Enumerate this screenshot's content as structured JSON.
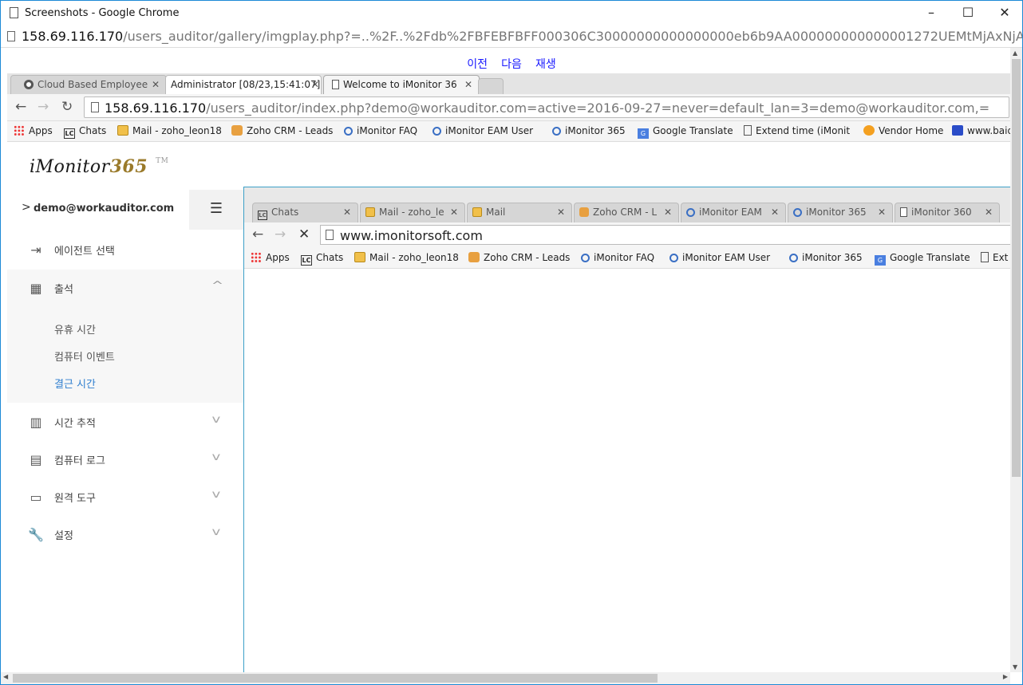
{
  "window": {
    "title": "Screenshots - Google Chrome",
    "url_host": "158.69.116.170",
    "url_path": "/users_auditor/gallery/imgplay.php?=..%2F..%2Fdb%2FBFEBFBFF000306C30000000000000000eb6b9AA000000000000001272UEMtMjAxNjA1MTQxN"
  },
  "player_nav": {
    "prev": "이전",
    "next": "다음",
    "play": "재생"
  },
  "inner_browser": {
    "tabs": [
      {
        "label": "Cloud Based Employee"
      },
      {
        "label": "Administrator [08/23,15:41:07]"
      },
      {
        "label": "Welcome to iMonitor 36"
      }
    ],
    "url_host": "158.69.116.170",
    "url_path": "/users_auditor/index.php?demo@workauditor.com=active=2016-09-27=never=default_lan=3=demo@workauditor.com,=",
    "bookmarks": [
      {
        "label": "Apps",
        "icon": "apps-icon"
      },
      {
        "label": "Chats",
        "icon": "lc-icon"
      },
      {
        "label": "Mail - zoho_leon18",
        "icon": "mail-icon"
      },
      {
        "label": "Zoho CRM - Leads",
        "icon": "crm-icon"
      },
      {
        "label": "iMonitor FAQ",
        "icon": "magnifier-icon"
      },
      {
        "label": "iMonitor EAM User",
        "icon": "magnifier-icon"
      },
      {
        "label": "iMonitor 365",
        "icon": "magnifier-icon"
      },
      {
        "label": "Google Translate",
        "icon": "translate-icon"
      },
      {
        "label": "Extend time (iMonit",
        "icon": "document-icon"
      },
      {
        "label": "Vendor Home",
        "icon": "vendor-icon"
      },
      {
        "label": "www.baid",
        "icon": "paw-icon"
      }
    ]
  },
  "app": {
    "logo_main": "iMonitor",
    "logo_accent": "365",
    "logo_tm": "TM",
    "user": "demo@workauditor.com",
    "menu": [
      {
        "label": "에이전트 선택",
        "icon": "sign-out-icon"
      },
      {
        "label": "출석",
        "icon": "calendar-icon"
      },
      {
        "label": "시간 추적",
        "icon": "bar-chart-icon"
      },
      {
        "label": "컴퓨터 로그",
        "icon": "file-icon"
      },
      {
        "label": "원격 도구",
        "icon": "list-icon"
      },
      {
        "label": "설정",
        "icon": "wrench-icon"
      }
    ],
    "attendance_submenu": [
      {
        "label": "유휴 시간"
      },
      {
        "label": "컴퓨터 이벤트"
      },
      {
        "label": "결근 시간"
      }
    ]
  },
  "embedded_screenshot": {
    "tabs": [
      {
        "label": "Chats"
      },
      {
        "label": "Mail - zoho_le"
      },
      {
        "label": "Mail"
      },
      {
        "label": "Zoho CRM - L"
      },
      {
        "label": "iMonitor EAM"
      },
      {
        "label": "iMonitor 365"
      },
      {
        "label": "iMonitor 360"
      }
    ],
    "url": "www.imonitorsoft.com",
    "bookmarks": [
      {
        "label": "Apps"
      },
      {
        "label": "Chats"
      },
      {
        "label": "Mail - zoho_leon18"
      },
      {
        "label": "Zoho CRM - Leads"
      },
      {
        "label": "iMonitor FAQ"
      },
      {
        "label": "iMonitor EAM User"
      },
      {
        "label": "iMonitor 365"
      },
      {
        "label": "Google Translate"
      },
      {
        "label": "Ext"
      }
    ]
  }
}
